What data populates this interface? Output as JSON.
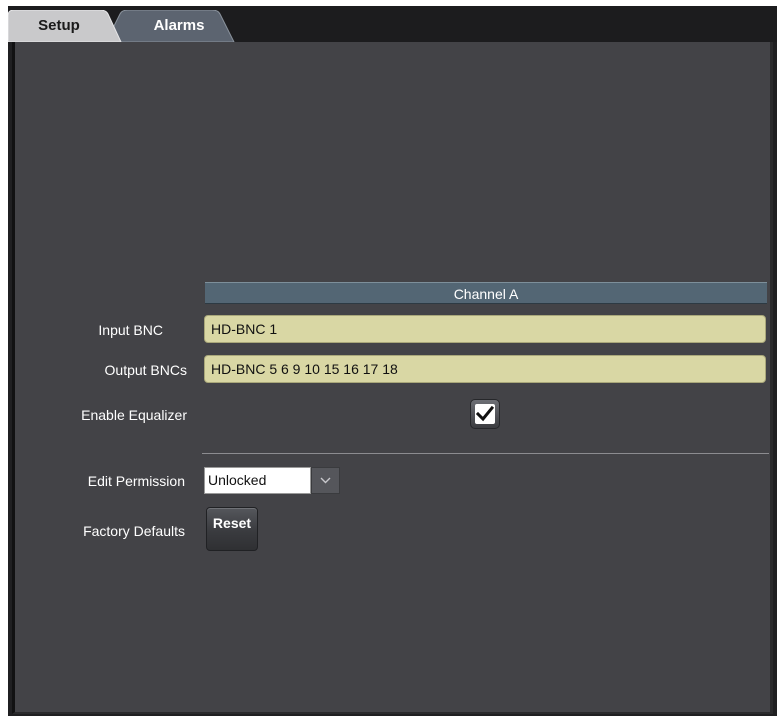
{
  "tabs": [
    {
      "label": "Setup",
      "active": true
    },
    {
      "label": "Alarms",
      "active": false
    }
  ],
  "channel": {
    "header": "Channel A"
  },
  "fields": {
    "input_bnc": {
      "label": "Input BNC",
      "value": "HD-BNC 1"
    },
    "output_bncs": {
      "label": "Output BNCs",
      "value": "HD-BNC 5 6 9 10 15 16 17 18"
    },
    "enable_equalizer": {
      "label": "Enable Equalizer",
      "checked": true
    },
    "edit_permission": {
      "label": "Edit Permission",
      "value": "Unlocked"
    },
    "factory_defaults": {
      "label": "Factory Defaults",
      "button_label": "Reset"
    }
  },
  "icons": {
    "checkmark": "check-icon",
    "dropdown": "chevron-down-icon"
  },
  "colors": {
    "panel_background": "#434347",
    "field_background": "#d9d7a4",
    "channel_header": "#536674",
    "active_tab": "#c9c9cb",
    "inactive_tab": "#5c6470"
  }
}
